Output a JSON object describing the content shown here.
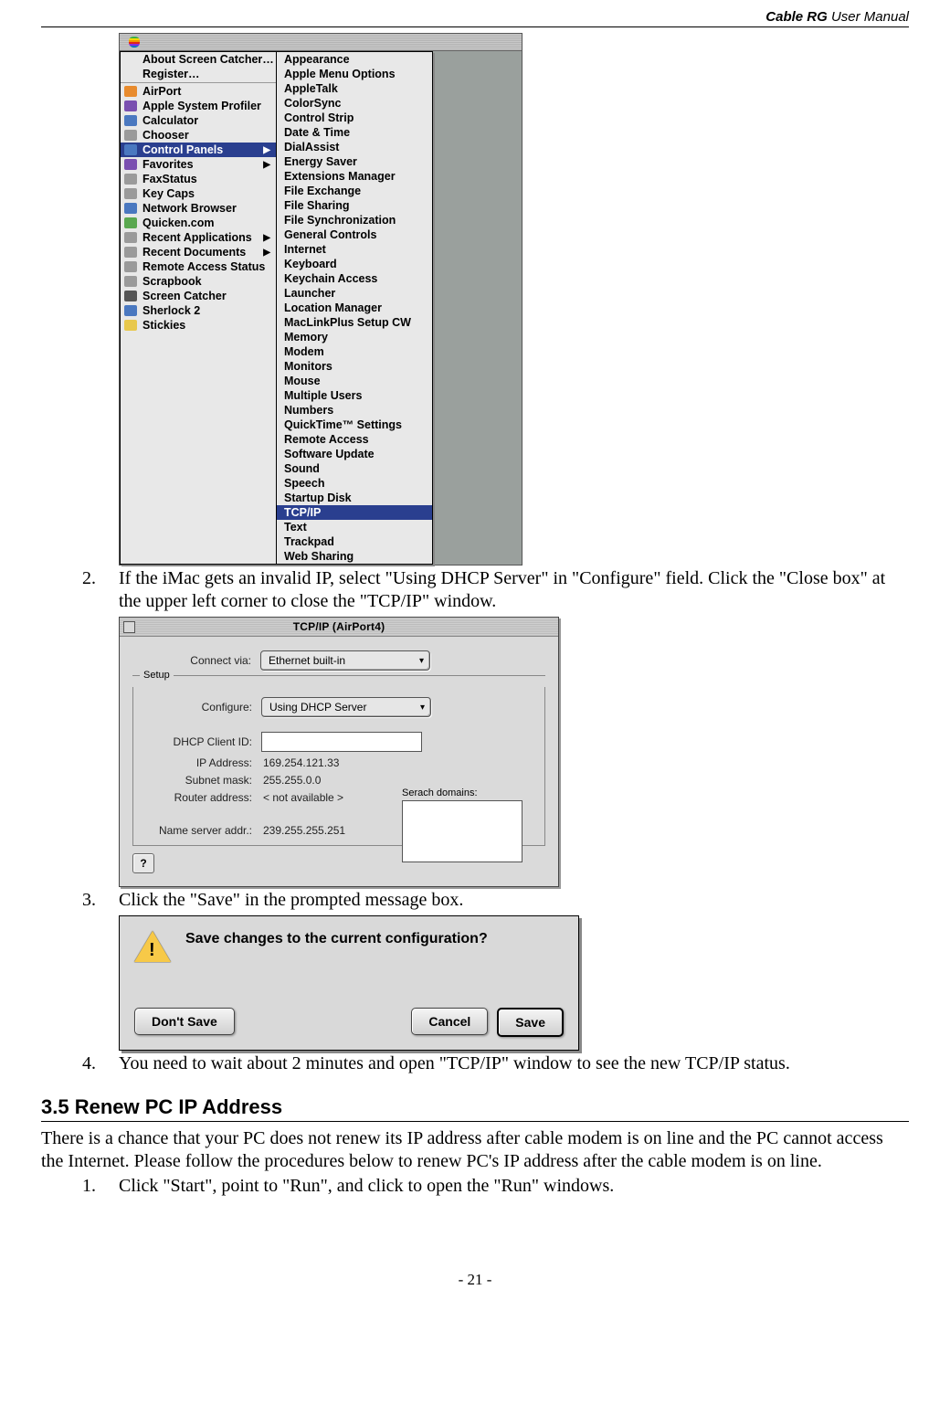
{
  "header": {
    "title_bold": "Cable RG",
    "title_rest": " User Manual"
  },
  "mac_menu": {
    "left_items": [
      {
        "label": "About Screen Catcher…",
        "icon": ""
      },
      {
        "label": "Register…",
        "icon": ""
      },
      {
        "label": "AirPort",
        "icon": "ic-orange"
      },
      {
        "label": "Apple System Profiler",
        "icon": "ic-purple"
      },
      {
        "label": "Calculator",
        "icon": "ic-blue"
      },
      {
        "label": "Chooser",
        "icon": "ic-grey"
      },
      {
        "label": "Control Panels",
        "icon": "ic-blue",
        "selected": true,
        "arrow": true
      },
      {
        "label": "Favorites",
        "icon": "ic-purple",
        "arrow": true
      },
      {
        "label": "FaxStatus",
        "icon": "ic-grey"
      },
      {
        "label": "Key Caps",
        "icon": "ic-grey"
      },
      {
        "label": "Network Browser",
        "icon": "ic-blue"
      },
      {
        "label": "Quicken.com",
        "icon": "ic-green"
      },
      {
        "label": "Recent Applications",
        "icon": "ic-grey",
        "arrow": true
      },
      {
        "label": "Recent Documents",
        "icon": "ic-grey",
        "arrow": true
      },
      {
        "label": "Remote Access Status",
        "icon": "ic-grey"
      },
      {
        "label": "Scrapbook",
        "icon": "ic-grey"
      },
      {
        "label": "Screen Catcher",
        "icon": "ic-dark"
      },
      {
        "label": "Sherlock 2",
        "icon": "ic-blue"
      },
      {
        "label": "Stickies",
        "icon": "ic-yellow"
      }
    ],
    "right_items": [
      "Appearance",
      "Apple Menu Options",
      "AppleTalk",
      "ColorSync",
      "Control Strip",
      "Date & Time",
      "DialAssist",
      "Energy Saver",
      "Extensions Manager",
      "File Exchange",
      "File Sharing",
      "File Synchronization",
      "General Controls",
      "Internet",
      "Keyboard",
      "Keychain Access",
      "Launcher",
      "Location Manager",
      "MacLinkPlus Setup CW",
      "Memory",
      "Modem",
      "Monitors",
      "Mouse",
      "Multiple Users",
      "Numbers",
      "QuickTime™ Settings",
      "Remote Access",
      "Software Update",
      "Sound",
      "Speech",
      "Startup Disk",
      {
        "label": "TCP/IP",
        "selected": true
      },
      "Text",
      "Trackpad",
      "Web Sharing"
    ]
  },
  "steps": {
    "s2_num": "2.",
    "s2_text": "If the iMac gets an invalid IP, select \"Using DHCP Server\" in \"Configure\" field. Click the \"Close box\" at the upper left corner to close the \"TCP/IP\" window.",
    "s3_num": "3.",
    "s3_text": "Click the \"Save\" in the prompted message box.",
    "s4_num": "4.",
    "s4_text": "You need to wait about 2 minutes and open \"TCP/IP\" window to see the new TCP/IP status."
  },
  "tcpip": {
    "title": "TCP/IP (AirPort4)",
    "connect_label": "Connect via:",
    "connect_value": "Ethernet built-in",
    "setup_legend": "Setup",
    "configure_label": "Configure:",
    "configure_value": "Using DHCP Server",
    "dhcpid_label": "DHCP Client ID:",
    "dhcpid_value": "",
    "ip_label": "IP Address:",
    "ip_value": "169.254.121.33",
    "subnet_label": "Subnet mask:",
    "subnet_value": "255.255.0.0",
    "router_label": "Router address:",
    "router_value": "< not available >",
    "ns_label": "Name server addr.:",
    "ns_value": "239.255.255.251",
    "search_label": "Serach domains:",
    "help_label": "?"
  },
  "save_dialog": {
    "message": "Save changes to the current configuration?",
    "dont_save": "Don't Save",
    "cancel": "Cancel",
    "save": "Save"
  },
  "section": {
    "title": "3.5 Renew PC IP Address"
  },
  "section_body": "There is a chance that your PC does not renew its IP address after cable modem is on line and the PC cannot access the Internet. Please follow the procedures below to renew PC's IP address after the cable modem is on line.",
  "section_step1_num": "1.",
  "section_step1_text": "Click \"Start\", point to \"Run\", and click to open the \"Run\" windows.",
  "footer": {
    "page": "- 21 -"
  }
}
